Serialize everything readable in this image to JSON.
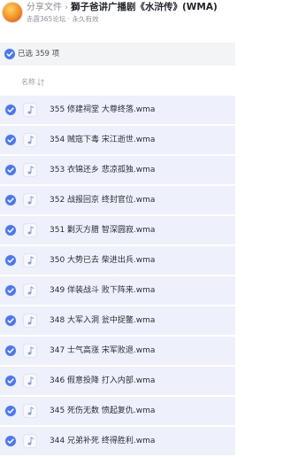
{
  "header": {
    "breadcrumb_root": "分享文件",
    "breadcrumb_sep": "›",
    "title": "獅子爸讲广播剧《水浒传》(WMA)",
    "subtitle": "赤霞365论坛 · 永久有效"
  },
  "toolbar": {
    "selected_label": "已选 359 项",
    "selected_count": 359
  },
  "columns": {
    "name_label": "名称"
  },
  "files": [
    {
      "name": "355 修建祠堂 大尊终落.wma",
      "checked": true,
      "icon": "music-file-icon"
    },
    {
      "name": "354 贼寇下毒 宋江逝世.wma",
      "checked": true,
      "icon": "music-file-icon"
    },
    {
      "name": "353 衣锦还乡 悲凉孤独.wma",
      "checked": true,
      "icon": "music-file-icon"
    },
    {
      "name": "352 战报回京 终封官位.wma",
      "checked": true,
      "icon": "music-file-icon"
    },
    {
      "name": "351 剿灭方腊 智深圆寂.wma",
      "checked": true,
      "icon": "music-file-icon"
    },
    {
      "name": "350 大势已去 柴进出兵.wma",
      "checked": true,
      "icon": "music-file-icon"
    },
    {
      "name": "349 佯装战斗 败下阵来.wma",
      "checked": true,
      "icon": "music-file-icon"
    },
    {
      "name": "348 大军入洞 瓮中捉鳖.wma",
      "checked": true,
      "icon": "music-file-icon"
    },
    {
      "name": "347 士气高涨 宋军败退.wma",
      "checked": true,
      "icon": "music-file-icon"
    },
    {
      "name": "346 假意投降 打入内部.wma",
      "checked": true,
      "icon": "music-file-icon"
    },
    {
      "name": "345 死伤无数 愤起复仇.wma",
      "checked": true,
      "icon": "music-file-icon"
    },
    {
      "name": "344 兄弟补死 终得胜利.wma",
      "checked": true,
      "icon": "music-file-icon"
    }
  ],
  "colors": {
    "accent": "#4a77f5",
    "row_selected_bg": "#eef0fb",
    "toolbar_bg": "#f3f4f6"
  }
}
